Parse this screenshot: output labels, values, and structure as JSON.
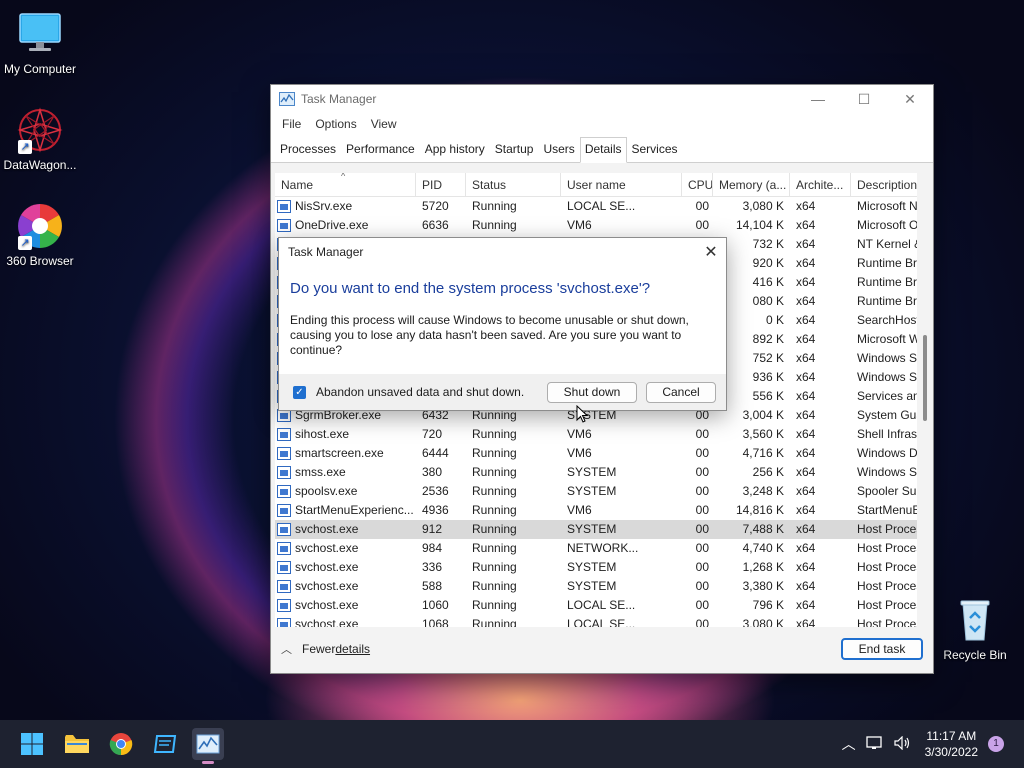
{
  "desktop": {
    "icons": [
      {
        "label": "My Computer"
      },
      {
        "label": "DataWagon..."
      },
      {
        "label": "360 Browser"
      },
      {
        "label": "Recycle Bin"
      }
    ]
  },
  "taskmanager": {
    "title": "Task Manager",
    "menu": [
      "File",
      "Options",
      "View"
    ],
    "tabs": [
      {
        "label": "Processes"
      },
      {
        "label": "Performance"
      },
      {
        "label": "App history"
      },
      {
        "label": "Startup"
      },
      {
        "label": "Users"
      },
      {
        "label": "Details",
        "active": true
      },
      {
        "label": "Services"
      }
    ],
    "columns": [
      "Name",
      "PID",
      "Status",
      "User name",
      "CPU",
      "Memory (a...",
      "Archite...",
      "Description"
    ],
    "rows": [
      {
        "name": "NisSrv.exe",
        "pid": "5720",
        "status": "Running",
        "user": "LOCAL SE...",
        "cpu": "00",
        "mem": "3,080 K",
        "arch": "x64",
        "desc": "Microsoft Net..."
      },
      {
        "name": "OneDrive.exe",
        "pid": "6636",
        "status": "Running",
        "user": "VM6",
        "cpu": "00",
        "mem": "14,104 K",
        "arch": "x64",
        "desc": "Microsoft On..."
      },
      {
        "name": "",
        "pid": "",
        "status": "",
        "user": "",
        "cpu": "",
        "mem": "732 K",
        "arch": "x64",
        "desc": "NT Kernel & S..."
      },
      {
        "name": "",
        "pid": "",
        "status": "",
        "user": "",
        "cpu": "",
        "mem": "920 K",
        "arch": "x64",
        "desc": "Runtime Broker"
      },
      {
        "name": "",
        "pid": "",
        "status": "",
        "user": "",
        "cpu": "",
        "mem": "416 K",
        "arch": "x64",
        "desc": "Runtime Broker"
      },
      {
        "name": "",
        "pid": "",
        "status": "",
        "user": "",
        "cpu": "",
        "mem": "080 K",
        "arch": "x64",
        "desc": "Runtime Broker"
      },
      {
        "name": "",
        "pid": "",
        "status": "",
        "user": "",
        "cpu": "",
        "mem": "0 K",
        "arch": "x64",
        "desc": "SearchHost.exe"
      },
      {
        "name": "",
        "pid": "",
        "status": "",
        "user": "",
        "cpu": "",
        "mem": "892 K",
        "arch": "x64",
        "desc": "Microsoft Wi..."
      },
      {
        "name": "",
        "pid": "",
        "status": "",
        "user": "",
        "cpu": "",
        "mem": "752 K",
        "arch": "x64",
        "desc": "Windows Sec..."
      },
      {
        "name": "",
        "pid": "",
        "status": "",
        "user": "",
        "cpu": "",
        "mem": "936 K",
        "arch": "x64",
        "desc": "Windows Sec..."
      },
      {
        "name": "",
        "pid": "",
        "status": "",
        "user": "",
        "cpu": "",
        "mem": "556 K",
        "arch": "x64",
        "desc": "Services and ..."
      },
      {
        "name": "SgrmBroker.exe",
        "pid": "6432",
        "status": "Running",
        "user": "SYSTEM",
        "cpu": "00",
        "mem": "3,004 K",
        "arch": "x64",
        "desc": "System Guard..."
      },
      {
        "name": "sihost.exe",
        "pid": "720",
        "status": "Running",
        "user": "VM6",
        "cpu": "00",
        "mem": "3,560 K",
        "arch": "x64",
        "desc": "Shell Infrastru..."
      },
      {
        "name": "smartscreen.exe",
        "pid": "6444",
        "status": "Running",
        "user": "VM6",
        "cpu": "00",
        "mem": "4,716 K",
        "arch": "x64",
        "desc": "Windows Def..."
      },
      {
        "name": "smss.exe",
        "pid": "380",
        "status": "Running",
        "user": "SYSTEM",
        "cpu": "00",
        "mem": "256 K",
        "arch": "x64",
        "desc": "Windows Ses..."
      },
      {
        "name": "spoolsv.exe",
        "pid": "2536",
        "status": "Running",
        "user": "SYSTEM",
        "cpu": "00",
        "mem": "3,248 K",
        "arch": "x64",
        "desc": "Spooler SubS..."
      },
      {
        "name": "StartMenuExperienc...",
        "pid": "4936",
        "status": "Running",
        "user": "VM6",
        "cpu": "00",
        "mem": "14,816 K",
        "arch": "x64",
        "desc": "StartMenuEx..."
      },
      {
        "name": "svchost.exe",
        "pid": "912",
        "status": "Running",
        "user": "SYSTEM",
        "cpu": "00",
        "mem": "7,488 K",
        "arch": "x64",
        "desc": "Host Process ...",
        "selected": true
      },
      {
        "name": "svchost.exe",
        "pid": "984",
        "status": "Running",
        "user": "NETWORK...",
        "cpu": "00",
        "mem": "4,740 K",
        "arch": "x64",
        "desc": "Host Process ..."
      },
      {
        "name": "svchost.exe",
        "pid": "336",
        "status": "Running",
        "user": "SYSTEM",
        "cpu": "00",
        "mem": "1,268 K",
        "arch": "x64",
        "desc": "Host Process ..."
      },
      {
        "name": "svchost.exe",
        "pid": "588",
        "status": "Running",
        "user": "SYSTEM",
        "cpu": "00",
        "mem": "3,380 K",
        "arch": "x64",
        "desc": "Host Process ..."
      },
      {
        "name": "svchost.exe",
        "pid": "1060",
        "status": "Running",
        "user": "LOCAL SE...",
        "cpu": "00",
        "mem": "796 K",
        "arch": "x64",
        "desc": "Host Process ..."
      },
      {
        "name": "svchost.exe",
        "pid": "1068",
        "status": "Running",
        "user": "LOCAL SE...",
        "cpu": "00",
        "mem": "3,080 K",
        "arch": "x64",
        "desc": "Host Process ..."
      }
    ],
    "footer": {
      "fewer_prefix": "Fewer ",
      "fewer_underlined": "details",
      "end_task": "End task"
    }
  },
  "dialog": {
    "title": "Task Manager",
    "heading": "Do you want to end the system process 'svchost.exe'?",
    "body": "Ending this process will cause Windows to become unusable or shut down, causing you to lose any data hasn't been saved. Are you sure you want to continue?",
    "checkbox_label": "Abandon unsaved data and shut down.",
    "checkbox_checked": true,
    "shutdown_label": "Shut down",
    "cancel_label": "Cancel"
  },
  "taskbar": {
    "time": "11:17 AM",
    "date": "3/30/2022",
    "notification_count": "1"
  },
  "colors": {
    "accent": "#1f6fcf",
    "dialog_heading": "#1a3e9c",
    "selected_row": "#d9d9d9",
    "taskbar": "#1e2230"
  }
}
